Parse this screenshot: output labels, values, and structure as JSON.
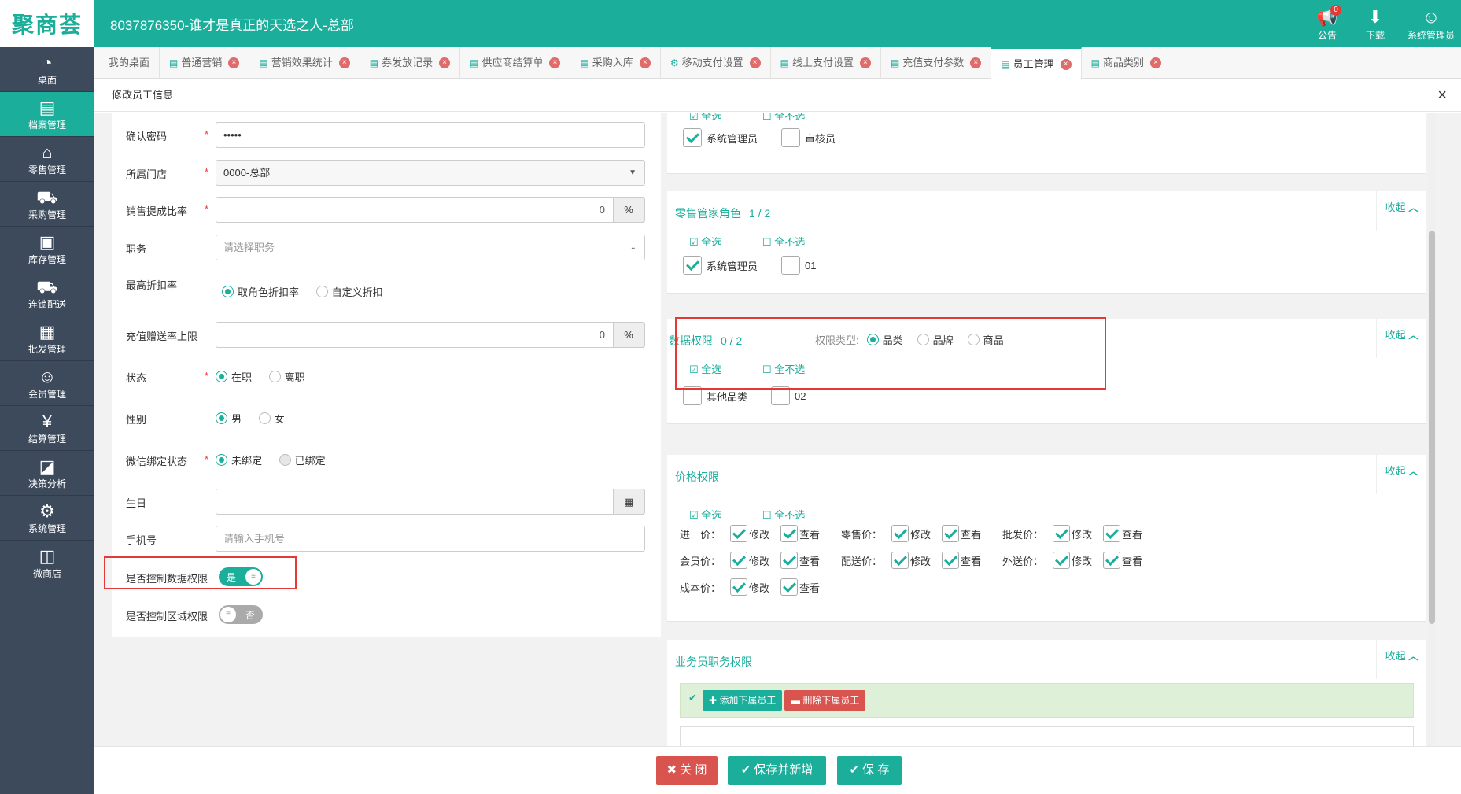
{
  "header": {
    "logo": "聚商荟",
    "store_title": "8037876350-谁才是真正的天选之人-总部",
    "notice_label": "公告",
    "notice_count": "0",
    "download_label": "下载",
    "user_label": "系统管理员"
  },
  "sidebar": {
    "items": [
      {
        "label": "桌面",
        "icon": "dashboard-icon"
      },
      {
        "label": "档案管理",
        "icon": "archive-icon"
      },
      {
        "label": "零售管理",
        "icon": "store-icon"
      },
      {
        "label": "采购管理",
        "icon": "cart-icon"
      },
      {
        "label": "库存管理",
        "icon": "inventory-icon"
      },
      {
        "label": "连锁配送",
        "icon": "truck-icon"
      },
      {
        "label": "批发管理",
        "icon": "wholesale-icon"
      },
      {
        "label": "会员管理",
        "icon": "member-icon"
      },
      {
        "label": "结算管理",
        "icon": "yen-icon"
      },
      {
        "label": "决策分析",
        "icon": "chart-icon"
      },
      {
        "label": "系统管理",
        "icon": "gear-icon"
      },
      {
        "label": "微商店",
        "icon": "shop-bag-icon"
      }
    ]
  },
  "tabs": [
    {
      "label": "我的桌面"
    },
    {
      "label": "普通营销"
    },
    {
      "label": "营销效果统计"
    },
    {
      "label": "券发放记录"
    },
    {
      "label": "供应商结算单"
    },
    {
      "label": "采购入库"
    },
    {
      "label": "移动支付设置"
    },
    {
      "label": "线上支付设置"
    },
    {
      "label": "充值支付参数"
    },
    {
      "label": "员工管理"
    },
    {
      "label": "商品类别"
    }
  ],
  "modal": {
    "title": "修改员工信息",
    "close": "×"
  },
  "form": {
    "confirm_password": {
      "label": "确认密码",
      "value": "•••••"
    },
    "store": {
      "label": "所属门店",
      "value": "0000-总部"
    },
    "commission": {
      "label": "销售提成比率",
      "value": "0",
      "unit": "%"
    },
    "position": {
      "label": "职务",
      "placeholder": "请选择职务"
    },
    "max_discount": {
      "label": "最高折扣率",
      "opt1": "取角色折扣率",
      "opt2": "自定义折扣"
    },
    "recharge_limit": {
      "label": "充值赠送率上限",
      "value": "0",
      "unit": "%"
    },
    "status": {
      "label": "状态",
      "opt1": "在职",
      "opt2": "离职"
    },
    "gender": {
      "label": "性别",
      "opt1": "男",
      "opt2": "女"
    },
    "wechat": {
      "label": "微信绑定状态",
      "opt1": "未绑定",
      "opt2": "已绑定"
    },
    "birthday": {
      "label": "生日"
    },
    "phone": {
      "label": "手机号",
      "placeholder": "请输入手机号"
    },
    "data_perm_ctrl": {
      "label": "是否控制数据权限",
      "toggle": "是"
    },
    "area_perm_ctrl": {
      "label": "是否控制区域权限",
      "toggle": "否"
    }
  },
  "right": {
    "top_partial": {
      "select_all": "全选",
      "deselect_all": "全不选",
      "roles": [
        "系统管理员",
        "审核员"
      ]
    },
    "retail_role": {
      "title": "零售管家角色",
      "count": "1 / 2",
      "collapse": "收起",
      "select_all": "全选",
      "deselect_all": "全不选",
      "items": [
        "系统管理员",
        "01"
      ]
    },
    "data_perm": {
      "title": "数据权限",
      "count": "0 / 2",
      "type_label": "权限类型:",
      "type1": "品类",
      "type2": "品牌",
      "type3": "商品",
      "collapse": "收起",
      "select_all": "全选",
      "deselect_all": "全不选",
      "items": [
        "其他品类",
        "02"
      ]
    },
    "price_perm": {
      "title": "价格权限",
      "collapse": "收起",
      "select_all": "全选",
      "deselect_all": "全不选",
      "edit": "修改",
      "view": "查看",
      "rows": [
        [
          "进　价：",
          "零售价：",
          "批发价："
        ],
        [
          "会员价：",
          "配送价：",
          "外送价："
        ],
        [
          "成本价："
        ]
      ]
    },
    "sales_perm": {
      "title": "业务员职务权限",
      "collapse": "收起",
      "add_btn": "添加下属员工",
      "del_btn": "删除下属员工"
    }
  },
  "footer": {
    "close_btn": "关 闭",
    "save_new_btn": "保存并新增",
    "save_btn": "保 存"
  }
}
